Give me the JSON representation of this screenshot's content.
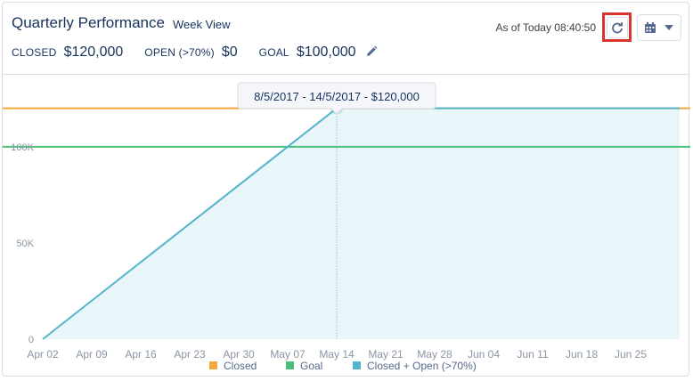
{
  "header": {
    "title": "Quarterly Performance",
    "view": "Week View",
    "as_of": "As of Today 08:40:50"
  },
  "metrics": {
    "closed_label": "CLOSED",
    "closed_value": "$120,000",
    "open_label": "OPEN (>70%)",
    "open_value": "$0",
    "goal_label": "GOAL",
    "goal_value": "$100,000"
  },
  "icons": {
    "edit": "pencil-icon",
    "refresh": "refresh-icon",
    "calendar": "calendar-icon",
    "dropdown": "chevron-down-icon"
  },
  "colors": {
    "closed": "#f4a83b",
    "goal": "#4bc07a",
    "combined": "#54b4cc",
    "combined_fill": "#e8f6f9",
    "highlight_box": "#d9352f"
  },
  "chart_data": {
    "type": "line",
    "x_ticks": [
      "Apr 02",
      "Apr 09",
      "Apr 16",
      "Apr 23",
      "Apr 30",
      "May 07",
      "May 14",
      "May 21",
      "May 28",
      "Jun 04",
      "Jun 11",
      "Jun 18",
      "Jun 25"
    ],
    "y_ticks": [
      "0",
      "50K",
      "100K"
    ],
    "ylim": [
      0,
      130000
    ],
    "series": [
      {
        "name": "Closed",
        "type": "hline",
        "value": 120000
      },
      {
        "name": "Goal",
        "type": "hline",
        "value": 100000
      },
      {
        "name": "Closed + Open (>70%)",
        "type": "area",
        "points": [
          {
            "x": "Apr 02",
            "y": 0
          },
          {
            "x": "May 14",
            "y": 120000
          },
          {
            "x": "Jun 25",
            "y": 120000
          }
        ]
      }
    ],
    "tooltip": {
      "text": "8/5/2017 - 14/5/2017 - $120,000",
      "x": "May 14",
      "y": 120000
    },
    "legend": [
      "Closed",
      "Goal",
      "Closed + Open (>70%)"
    ],
    "legend_position": "bottom",
    "grid": false
  }
}
